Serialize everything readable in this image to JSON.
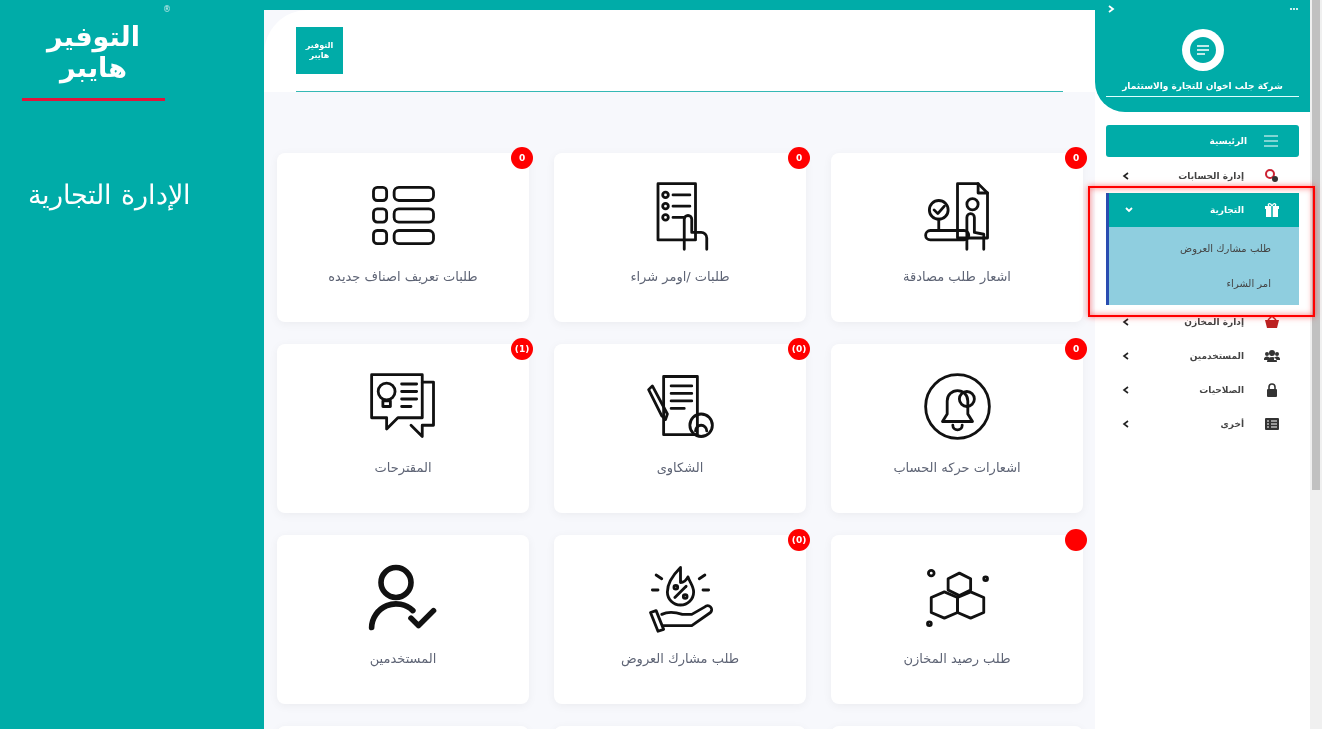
{
  "brand_panel": {
    "logo": {
      "lines": [
        "التوفير",
        "هايبر"
      ],
      "mark": "®"
    },
    "title": "الإدارة التجارية"
  },
  "header": {
    "logo": {
      "lines": [
        "التوفير",
        "هايبر"
      ]
    }
  },
  "cards": [
    {
      "label": "اشعار طلب مصادقة",
      "badge": "0"
    },
    {
      "label": "طلبات /اومر شراء",
      "badge": "0"
    },
    {
      "label": "طلبات تعريف اصناف جديده",
      "badge": "0"
    },
    {
      "label": "اشعارات حركه الحساب",
      "badge": "0"
    },
    {
      "label": "الشكاوى",
      "badge": "(0)"
    },
    {
      "label": "المقترحات",
      "badge": "(1)"
    },
    {
      "label": "طلب رصيد المخازن",
      "dot": true
    },
    {
      "label": "طلب مشارك العروض",
      "badge": "(0)"
    },
    {
      "label": "المستخدمين"
    }
  ],
  "sidebar": {
    "company": "شركة جلب اخوان للتجارة والاستثمار",
    "items": [
      {
        "kind": "button",
        "label": "الرئيسية",
        "selected": true
      },
      {
        "kind": "group",
        "label": "إدارة الحسابات",
        "expanded": false
      },
      {
        "kind": "group",
        "label": "التجارية",
        "expanded": true,
        "children": [
          {
            "label": "طلب مشارك العروض"
          },
          {
            "label": "امر الشراء"
          }
        ]
      },
      {
        "kind": "group",
        "label": "إدارة المخازن",
        "expanded": false
      },
      {
        "kind": "group",
        "label": "المستخدمين",
        "expanded": false
      },
      {
        "kind": "group",
        "label": "الصلاحيات",
        "expanded": false
      },
      {
        "kind": "group",
        "label": "أخرى",
        "expanded": false
      }
    ]
  },
  "highlight": {
    "shown": true
  }
}
